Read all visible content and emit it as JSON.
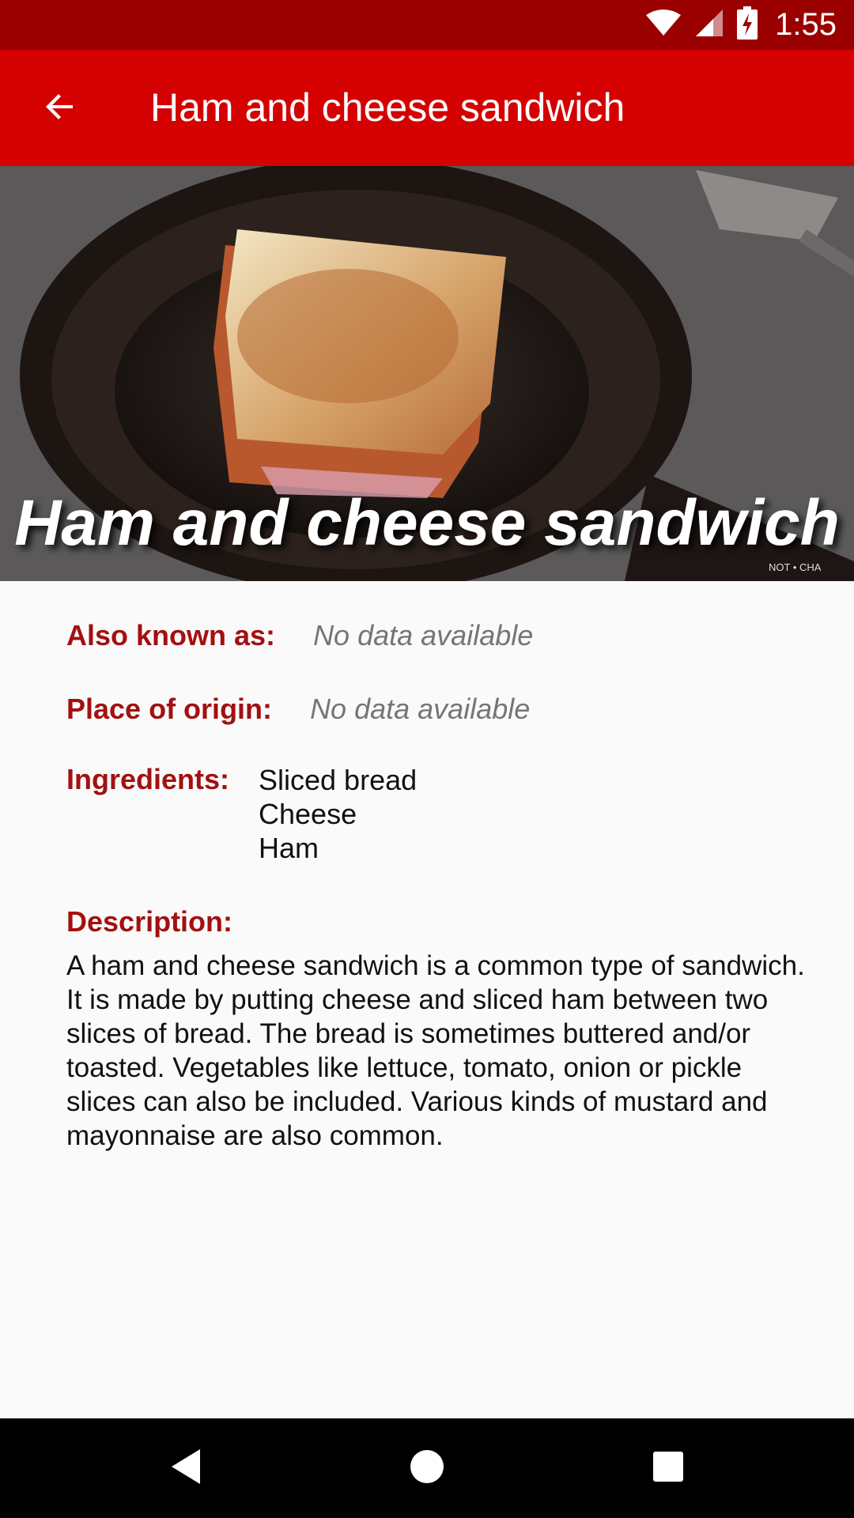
{
  "status_bar": {
    "time": "1:55",
    "icons": [
      "wifi-icon",
      "cell-signal-icon",
      "battery-charging-icon"
    ]
  },
  "app_bar": {
    "title": "Ham and cheese sandwich",
    "back_icon": "arrow-back-icon",
    "color": "#d50000"
  },
  "hero": {
    "title": "Ham and cheese sandwich",
    "watermark": "NOT • CHA"
  },
  "details": {
    "also_known_as": {
      "label": "Also known as:",
      "value": "No data available"
    },
    "place_of_origin": {
      "label": "Place of origin:",
      "value": "No data available"
    },
    "ingredients": {
      "label": "Ingredients:",
      "items": [
        "Sliced bread",
        "Cheese",
        "Ham"
      ]
    },
    "description": {
      "label": "Description:",
      "text": "A ham and cheese sandwich is a common type of sandwich. It is made by putting cheese and sliced ham between two slices of bread. The bread is sometimes buttered and/or toasted. Vegetables like lettuce, tomato, onion or pickle slices can also be included. Various kinds of mustard and mayonnaise are also common."
    }
  },
  "colors": {
    "label": "#a31010",
    "status_bar": "#9b0000"
  },
  "nav_bar": {
    "buttons": [
      "back-triangle-icon",
      "home-circle-icon",
      "recents-square-icon"
    ]
  }
}
